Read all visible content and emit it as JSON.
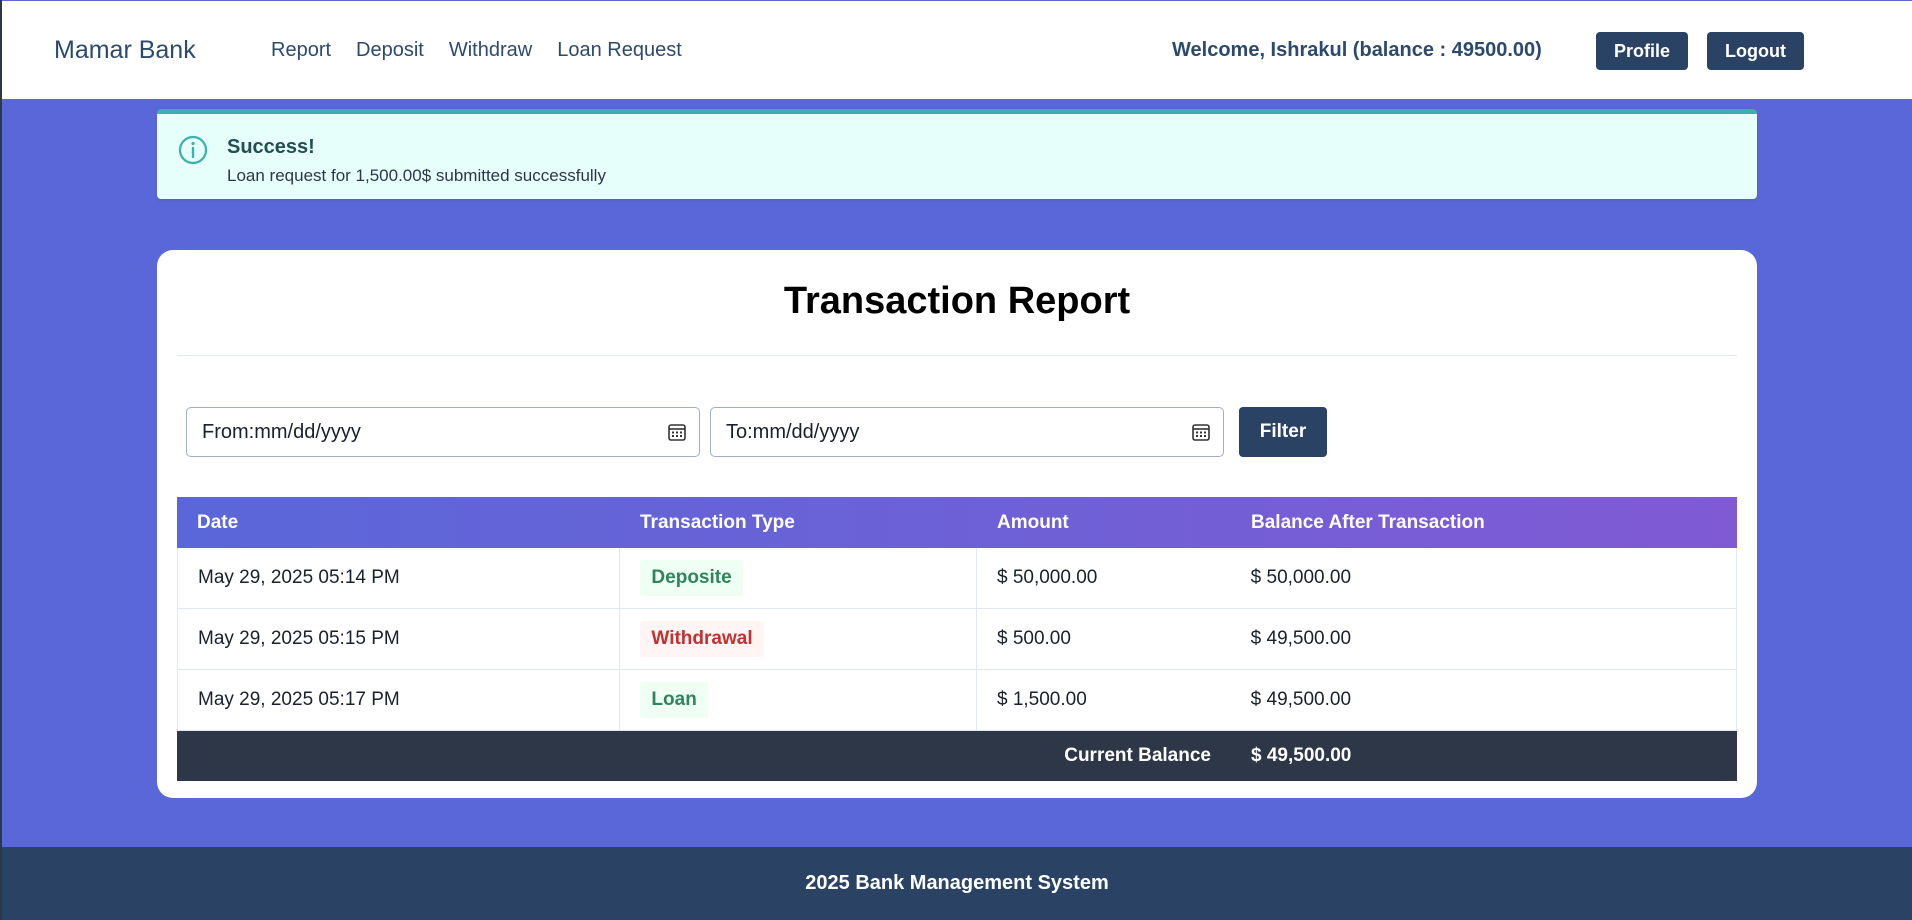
{
  "nav": {
    "brand": "Mamar Bank",
    "links": [
      "Report",
      "Deposit",
      "Withdraw",
      "Loan Request"
    ],
    "welcome": "Welcome, Ishrakul (balance : 49500.00)",
    "profile_label": "Profile",
    "logout_label": "Logout"
  },
  "alert": {
    "icon": "info-circle-icon",
    "title": "Success!",
    "message": "Loan request for 1,500.00$ submitted successfully",
    "color": "#38b2ac"
  },
  "report": {
    "title": "Transaction Report",
    "from_placeholder": "From:mm/dd/yyyy",
    "to_placeholder": "To:mm/dd/yyyy",
    "filter_label": "Filter",
    "columns": [
      "Date",
      "Transaction Type",
      "Amount",
      "Balance After Transaction"
    ],
    "rows": [
      {
        "date": "May 29, 2025 05:14 PM",
        "type": "Deposite",
        "type_color": "green",
        "amount": "$ 50,000.00",
        "balance": "$ 50,000.00"
      },
      {
        "date": "May 29, 2025 05:15 PM",
        "type": "Withdrawal",
        "type_color": "red",
        "amount": "$ 500.00",
        "balance": "$ 49,500.00"
      },
      {
        "date": "May 29, 2025 05:17 PM",
        "type": "Loan",
        "type_color": "green",
        "amount": "$ 1,500.00",
        "balance": "$ 49,500.00"
      }
    ],
    "footer_label": "Current Balance",
    "footer_value": "$ 49,500.00"
  },
  "footer": {
    "text": "2025 Bank Management System"
  },
  "colors": {
    "background": "#5a67d8",
    "primary_dark": "#2a4365",
    "header_gradient_start": "#5a67d8",
    "header_gradient_end": "#805ad5"
  }
}
